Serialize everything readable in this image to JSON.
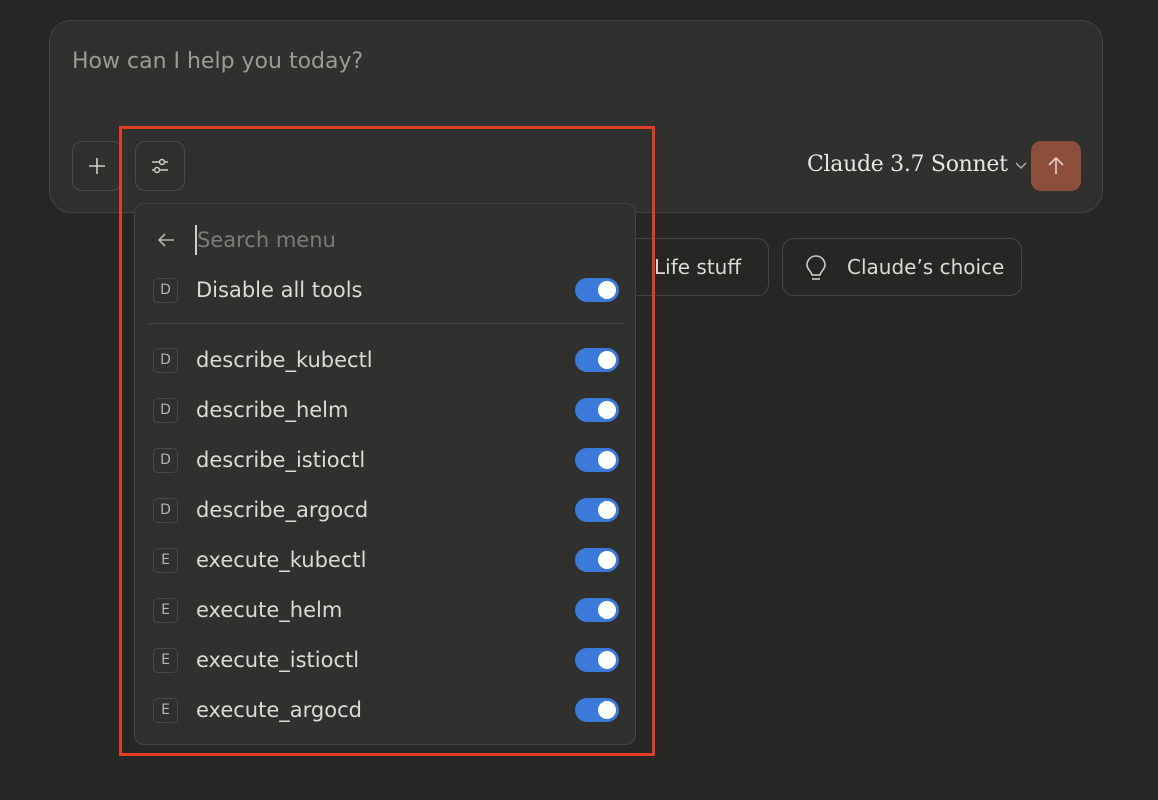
{
  "composer": {
    "placeholder": "How can I help you today?",
    "model": "Claude 3.7 Sonnet"
  },
  "chips": [
    {
      "label": "Life stuff",
      "icon": "lightbulb-icon"
    },
    {
      "label": "Claude’s choice",
      "icon": "lightbulb-icon"
    }
  ],
  "menu": {
    "search_placeholder": "Search menu",
    "disable_all": {
      "badge": "D",
      "label": "Disable all tools",
      "enabled": true
    },
    "tools": [
      {
        "badge": "D",
        "label": "describe_kubectl",
        "enabled": true
      },
      {
        "badge": "D",
        "label": "describe_helm",
        "enabled": true
      },
      {
        "badge": "D",
        "label": "describe_istioctl",
        "enabled": true
      },
      {
        "badge": "D",
        "label": "describe_argocd",
        "enabled": true
      },
      {
        "badge": "E",
        "label": "execute_kubectl",
        "enabled": true
      },
      {
        "badge": "E",
        "label": "execute_helm",
        "enabled": true
      },
      {
        "badge": "E",
        "label": "execute_istioctl",
        "enabled": true
      },
      {
        "badge": "E",
        "label": "execute_argocd",
        "enabled": true
      }
    ]
  },
  "colors": {
    "background": "#262624",
    "accent_toggle": "#3b7ad8",
    "send_button": "#8a4e3a",
    "highlight_border": "#e03b24"
  }
}
